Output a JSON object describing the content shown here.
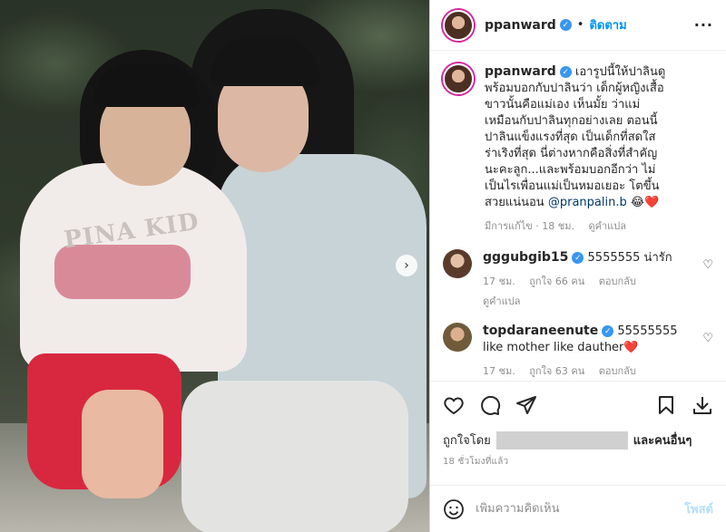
{
  "post": {
    "username": "ppanward",
    "follow_label": "ติดตาม",
    "caption": {
      "username": "ppanward",
      "text": "เอารูปนี้ให้ปาลินดู\nพร้อมบอกกับปาลินว่า เด็กผู้หญิงเสื้อ\nขาวนั้นคือแม่เอง เห็นมั้ย ว่าแม่\nเหมือนกับปาลินทุกอย่างเลย ตอนนี้\nปาลินแข็งแรงที่สุด เป็นเด็กที่สดใส\nร่าเริงที่สุด นี่ต่างหากคือสิ่งที่สำคัญ\nนะคะลูก...และพร้อมบอกอีกว่า ไม่\nเป็นไรเพื่อนแม่เป็นหมอเยอะ โตขึ้น\nสวยแน่นอน",
      "mention": "@pranpalin.b",
      "emoji": "😂❤️",
      "edited": "มีการแก้ไข · 18 ชม.",
      "translate": "ดูคำแปล"
    },
    "comments": [
      {
        "username": "gggubgib15",
        "text": "5555555 น่ารัก",
        "time": "17 ชม.",
        "likes": "ถูกใจ 66 คน",
        "reply": "ตอบกลับ",
        "translate": "ดูคำแปล"
      },
      {
        "username": "topdaraneenute",
        "text": "55555555",
        "text2": "like mother like dauther❤️",
        "time": "17 ชม.",
        "likes": "ถูกใจ 63 คน",
        "reply": "ตอบกลับ"
      }
    ],
    "liked_by_prefix": "ถูกใจโดย",
    "liked_by_suffix": "และคนอื่นๆ",
    "posted_time": "18 ชั่วโมงที่แล้ว",
    "comment_placeholder": "เพิ่มความคิดเห็น",
    "post_button": "โพสต์",
    "photo_text": "PINA KID"
  },
  "colors": {
    "accent": "#0095f6",
    "verified": "#3897f0"
  },
  "icons": [
    "heart-icon",
    "comment-icon",
    "share-icon",
    "bookmark-icon",
    "download-icon",
    "emoji-icon",
    "more-icon",
    "chevron-right-icon"
  ]
}
